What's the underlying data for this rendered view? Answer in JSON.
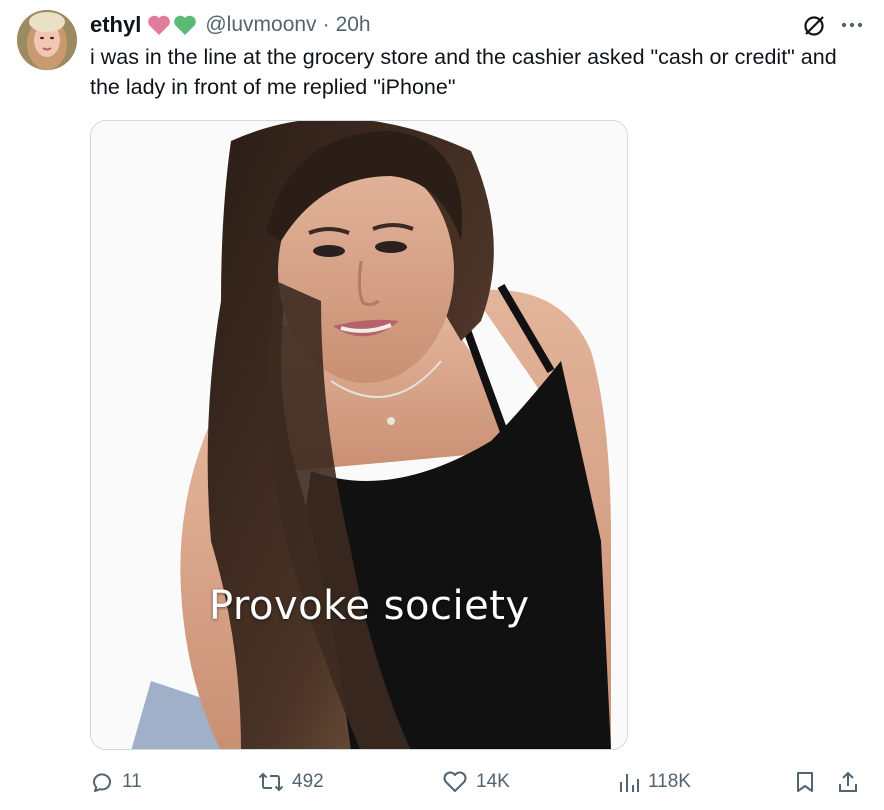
{
  "author": {
    "name": "ethyl",
    "handle": "@luvmoonv",
    "time": "20h",
    "separator": "·"
  },
  "tweet": {
    "text": "i was in the line at the grocery store and the cashier asked \"cash or credit\" and the lady in front of me replied \"iPhone\""
  },
  "media": {
    "caption": "Provoke society"
  },
  "metrics": {
    "replies": "11",
    "reposts": "492",
    "likes": "14K",
    "views": "118K"
  },
  "icons": {
    "heart_pink": "#e37b9b",
    "heart_green": "#5bb974",
    "grok": "slash-circle-icon",
    "more": "more-dots-icon"
  },
  "colors": {
    "text": "#0f1419",
    "muted": "#536471",
    "border": "#cfd9de"
  }
}
